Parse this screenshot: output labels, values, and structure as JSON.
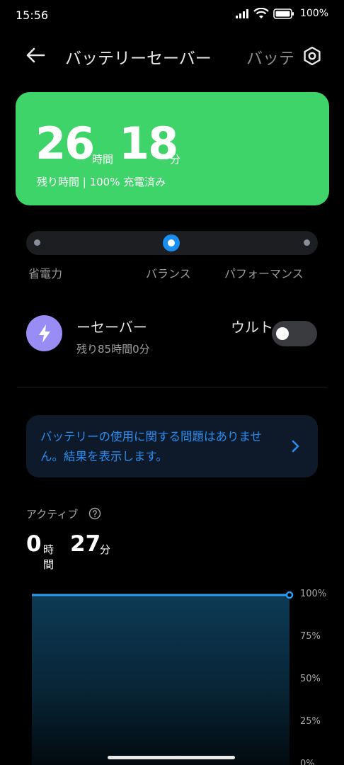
{
  "status_bar": {
    "time": "15:56",
    "battery_text": "100%",
    "icons": [
      "signal-icon",
      "wifi-icon",
      "battery-icon"
    ]
  },
  "header": {
    "title": "バッテリーセーバー",
    "title_overflow": "バッテ",
    "back_icon": "arrow-left-icon",
    "settings_icon": "hexagon-settings-icon"
  },
  "battery_card": {
    "hours": "26",
    "hours_unit": "時間",
    "minutes": "18",
    "minutes_unit": "分",
    "subtitle": "残り時間 | 100% 充電済み",
    "color": "#3fd46a"
  },
  "mode_slider": {
    "options": [
      "省電力",
      "バランス",
      "パフォーマンス"
    ],
    "selected": "バランス",
    "accent": "#1a8ef0"
  },
  "ultra_saver": {
    "title_left": "ーセーバー",
    "title_right": "ウルト",
    "subtitle": "残り85時間0分",
    "enabled": false,
    "icon": "lightning-icon",
    "icon_color": "#9a8cf5"
  },
  "info_card": {
    "text": "バッテリーの使用に関する問題はありません。結果を表示します。",
    "chevron_icon": "chevron-right-icon",
    "text_color": "#2a8df0"
  },
  "active": {
    "label": "アクティブ",
    "help_icon": "question-circle-icon",
    "hours": "0",
    "hours_unit": "時間",
    "minutes": "27",
    "minutes_unit": "分"
  },
  "chart_data": {
    "type": "area",
    "series": [
      {
        "values": [
          100,
          100
        ]
      }
    ],
    "ylim": [
      0,
      100
    ],
    "y_ticks": [
      "100%",
      "75%",
      "50%",
      "25%",
      "0%"
    ],
    "grid": true,
    "line_color": "#2a9df4"
  }
}
